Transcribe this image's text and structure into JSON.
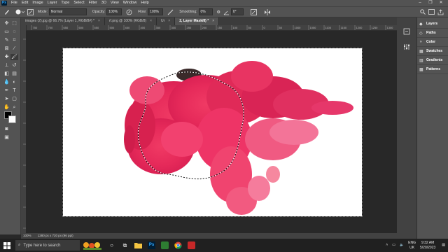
{
  "menubar": {
    "logo": "Ps",
    "items": [
      "File",
      "Edit",
      "Image",
      "Layer",
      "Type",
      "Select",
      "Filter",
      "3D",
      "View",
      "Window",
      "Help"
    ]
  },
  "options": {
    "mode_label": "Mode:",
    "mode_value": "Normal",
    "opacity_label": "Opacity:",
    "opacity_value": "100%",
    "flow_label": "Flow:",
    "flow_value": "100%",
    "smoothing_label": "Smoothing:",
    "smoothing_value": "0%",
    "angle_value": "0°"
  },
  "tabs": [
    {
      "label": "images (2).jpg @ 66.7% (Layer 1, RGB/8#) *",
      "active": false
    },
    {
      "label": "rf.png @ 100% (RGB/8)",
      "active": false
    },
    {
      "label": "Ur",
      "active": false
    },
    {
      "label": "2, Layer Mask/8) *",
      "active": true
    }
  ],
  "ruler_ticks": [
    "750",
    "700",
    "650",
    "600",
    "550",
    "500",
    "450",
    "400",
    "350",
    "300",
    "250",
    "200",
    "150",
    "100",
    "50",
    "0",
    "50",
    "1000",
    "1050",
    "1100",
    "1150",
    "1200",
    "1250",
    "1300"
  ],
  "status": {
    "zoom": "100%",
    "doc_size": "1280 px x 720 px (96 ppi)"
  },
  "panels": [
    {
      "icon": "layers-icon",
      "label": "Layers"
    },
    {
      "icon": "paths-icon",
      "label": "Paths"
    },
    {
      "icon": "color-icon",
      "label": "Color"
    },
    {
      "icon": "swatches-icon",
      "label": "Swatches"
    },
    {
      "icon": "gradients-icon",
      "label": "Gradients"
    },
    {
      "icon": "patterns-icon",
      "label": "Patterns"
    }
  ],
  "taskbar": {
    "search_placeholder": "Type here to search",
    "lang_top": "ENG",
    "lang_bottom": "UK",
    "time": "9:32 AM",
    "date": "5/20/2023"
  },
  "colors": {
    "accent_ink": "#e8285a",
    "ps_blue": "#31a8ff"
  }
}
